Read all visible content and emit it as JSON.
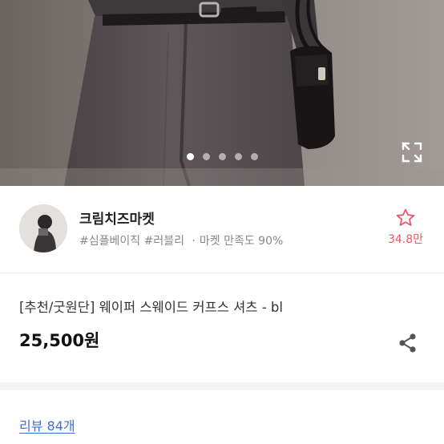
{
  "gallery": {
    "image_alt": "product photo - dark grey skirt with black belt and black leather shoulder bag",
    "slide_count": 5,
    "active_index": 0,
    "expand_icon": "expand-icon"
  },
  "shop": {
    "name": "크림치즈마켓",
    "tag_1": "#심플베이직",
    "tag_2": "#러블리",
    "separator": "·",
    "satisfaction": "마켓 만족도 90%",
    "favorite_icon": "star-outline-icon",
    "favorite_count": "34.8만"
  },
  "product": {
    "title": "[추천/굿원단] 웨이퍼 스웨이드 커프스 셔츠 - bl",
    "price": "25,500원",
    "share_icon": "share-icon"
  },
  "reviews": {
    "label": "리뷰 84개"
  },
  "colors": {
    "accent_pink": "#e85a6a",
    "link_blue": "#3d6fd6"
  }
}
